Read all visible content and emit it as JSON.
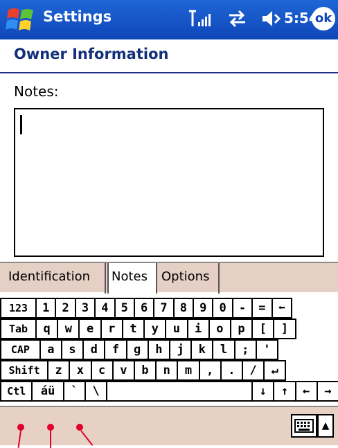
{
  "title_bar": {
    "app_title": "Settings",
    "clock": "5:54",
    "ok_label": "ok"
  },
  "page": {
    "heading": "Owner Information",
    "notes_label": "Notes:",
    "notes_value": ""
  },
  "tabs": [
    {
      "label": "Identification"
    },
    {
      "label": "Notes"
    },
    {
      "label": "Options"
    }
  ],
  "keyboard": {
    "rows": [
      [
        "123",
        "1",
        "2",
        "3",
        "4",
        "5",
        "6",
        "7",
        "8",
        "9",
        "0",
        "-",
        "=",
        "⬅"
      ],
      [
        "Tab",
        "q",
        "w",
        "e",
        "r",
        "t",
        "y",
        "u",
        "i",
        "o",
        "p",
        "[",
        "]"
      ],
      [
        "CAP",
        "a",
        "s",
        "d",
        "f",
        "g",
        "h",
        "j",
        "k",
        "l",
        ";",
        "'"
      ],
      [
        "Shift",
        "z",
        "x",
        "c",
        "v",
        "b",
        "n",
        "m",
        ",",
        ".",
        "/",
        "↵"
      ],
      [
        "Ctl",
        "áü",
        "`",
        "\\",
        "",
        "↓",
        "↑",
        "←",
        "→"
      ]
    ]
  },
  "bottom_bar": {
    "sip_arrow": "▲"
  },
  "colors": {
    "title_bar": "#1f66d6",
    "heading": "#132f7a",
    "tab_strip": "#e6cfc4",
    "marker": "#e0002a"
  }
}
